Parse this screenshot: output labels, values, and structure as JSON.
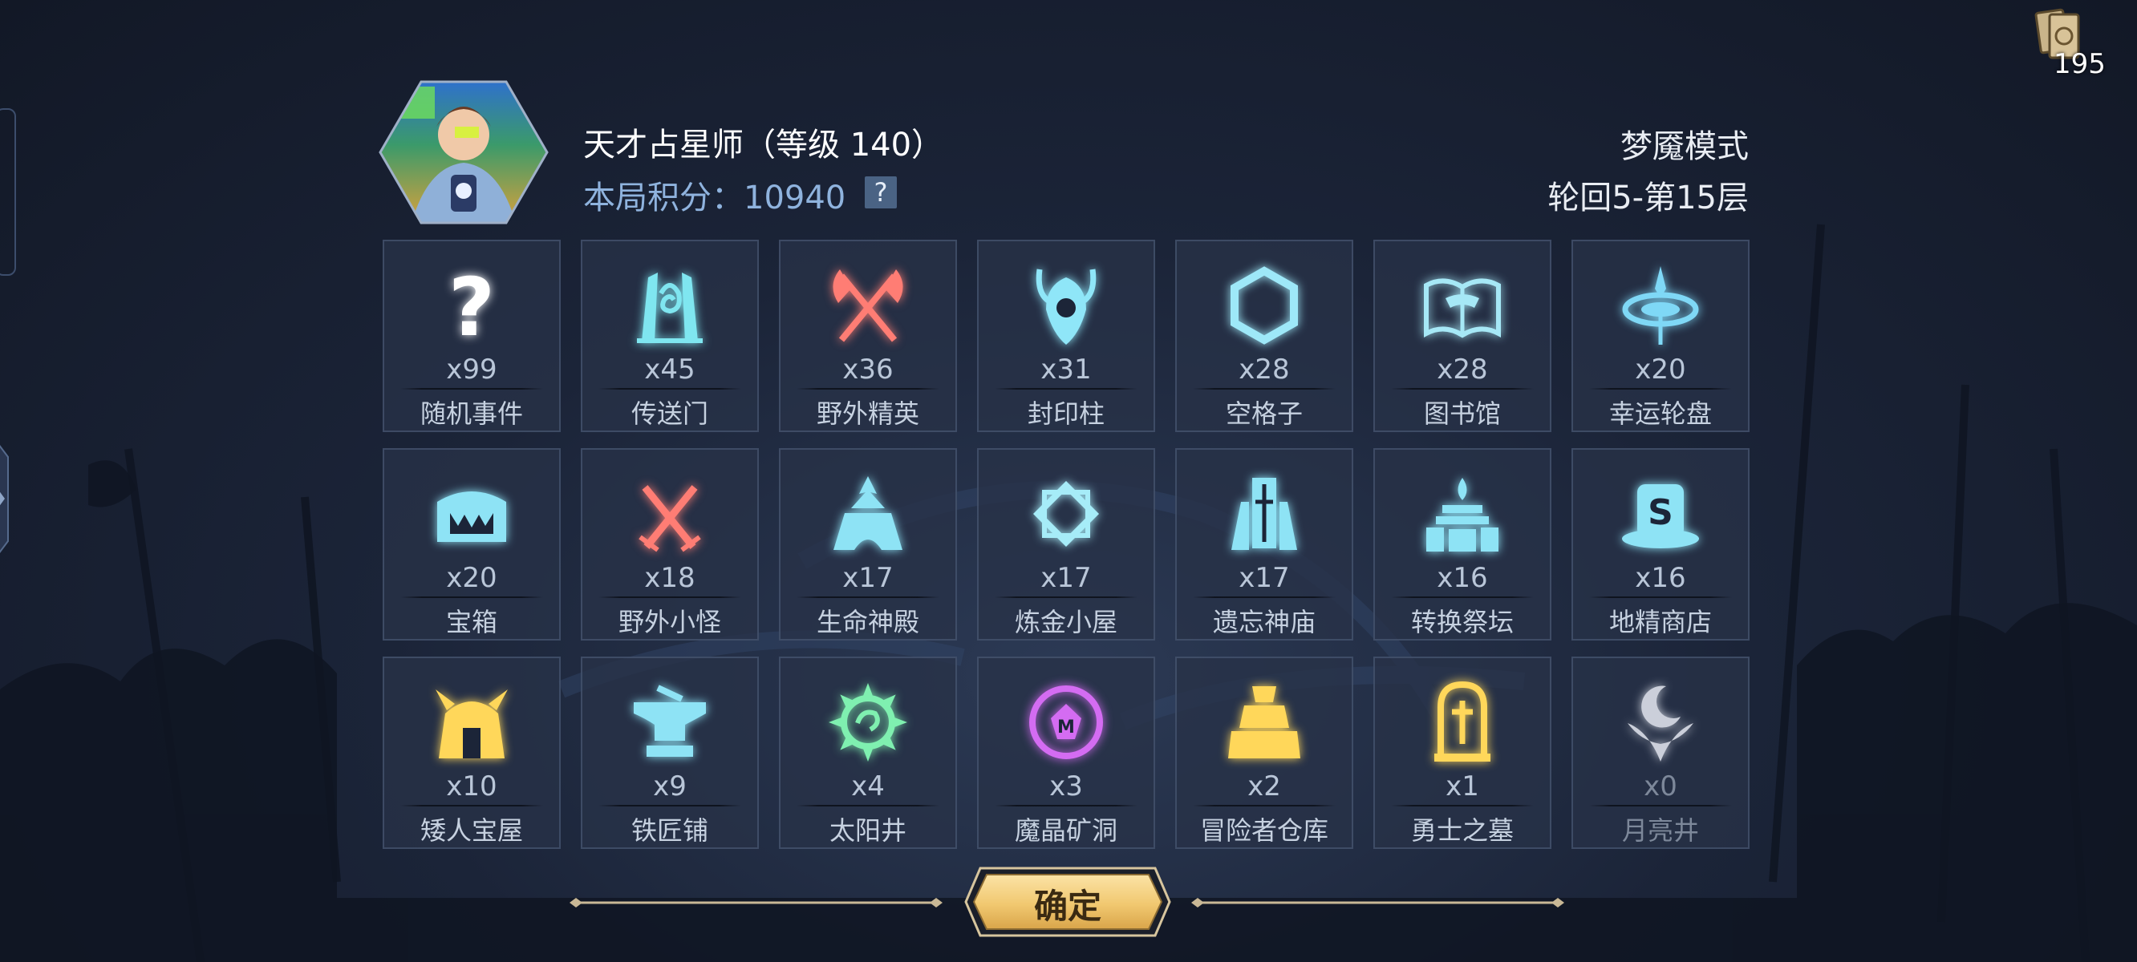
{
  "header": {
    "player_name": "天才占星师（等级 140）",
    "score_label": "本局积分：",
    "score_value": "10940",
    "score_help": "?",
    "mode": "梦魇模式",
    "cycle": "轮回5-第15层"
  },
  "card_counter": {
    "icon": "card-deck-icon",
    "count": "195"
  },
  "events": [
    {
      "name": "随机事件",
      "count": "x99",
      "icon": "question-icon",
      "color": "#ffffff"
    },
    {
      "name": "传送门",
      "count": "x45",
      "icon": "portal-icon",
      "color": "#7fe6f0"
    },
    {
      "name": "野外精英",
      "count": "x36",
      "icon": "crossed-axes-icon",
      "color": "#ff7d74"
    },
    {
      "name": "封印柱",
      "count": "x31",
      "icon": "seal-pillar-icon",
      "color": "#8fe6f8"
    },
    {
      "name": "空格子",
      "count": "x28",
      "icon": "hexagon-icon",
      "color": "#9ee8f8"
    },
    {
      "name": "图书馆",
      "count": "x28",
      "icon": "book-icon",
      "color": "#a6e8f6"
    },
    {
      "name": "幸运轮盘",
      "count": "x20",
      "icon": "wheel-icon",
      "color": "#7fd8f6"
    },
    {
      "name": "宝箱",
      "count": "x20",
      "icon": "chest-icon",
      "color": "#8ee3f5"
    },
    {
      "name": "野外小怪",
      "count": "x18",
      "icon": "crossed-swords-icon",
      "color": "#ff7d74"
    },
    {
      "name": "生命神殿",
      "count": "x17",
      "icon": "temple-icon",
      "color": "#8ee3f5"
    },
    {
      "name": "炼金小屋",
      "count": "x17",
      "icon": "alchemy-icon",
      "color": "#a6ecf8"
    },
    {
      "name": "遗忘神庙",
      "count": "x17",
      "icon": "shrine-icon",
      "color": "#8ee3f5"
    },
    {
      "name": "转换祭坛",
      "count": "x16",
      "icon": "altar-icon",
      "color": "#8ee3f5"
    },
    {
      "name": "地精商店",
      "count": "x16",
      "icon": "shop-icon",
      "color": "#8ee3f5"
    },
    {
      "name": "矮人宝屋",
      "count": "x10",
      "icon": "dwarf-house-icon",
      "color": "#ffd75a"
    },
    {
      "name": "铁匠铺",
      "count": "x9",
      "icon": "anvil-icon",
      "color": "#8ee3f5"
    },
    {
      "name": "太阳井",
      "count": "x4",
      "icon": "sun-well-icon",
      "color": "#7ff0b0"
    },
    {
      "name": "魔晶矿洞",
      "count": "x3",
      "icon": "crystal-mine-icon",
      "color": "#d46cf2"
    },
    {
      "name": "冒险者仓库",
      "count": "x2",
      "icon": "warehouse-icon",
      "color": "#ffd75a"
    },
    {
      "name": "勇士之墓",
      "count": "x1",
      "icon": "tomb-icon",
      "color": "#ffd75a"
    },
    {
      "name": "月亮井",
      "count": "x0",
      "icon": "moon-well-icon",
      "color": "#e8ecf4",
      "dim": true
    }
  ],
  "confirm_label": "确定"
}
